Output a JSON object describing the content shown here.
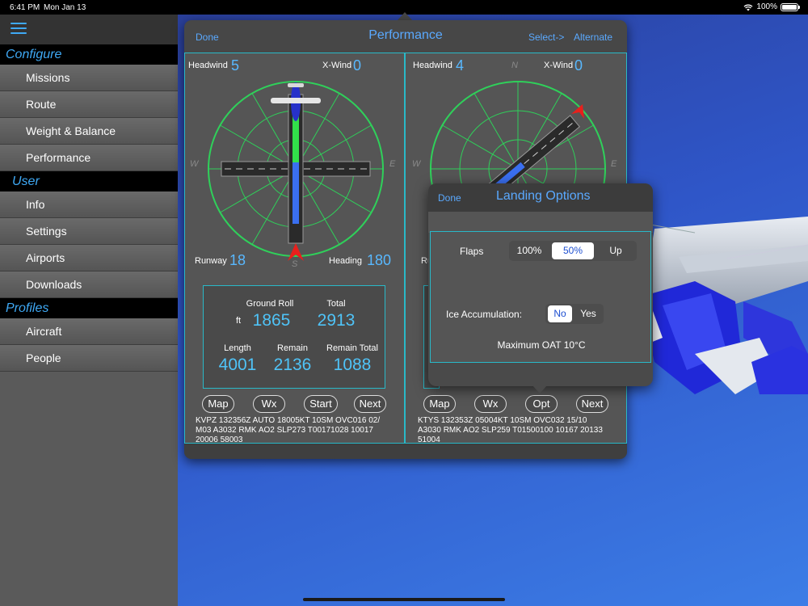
{
  "status_bar": {
    "time": "6:41 PM",
    "date": "Mon Jan 13",
    "battery": "100%"
  },
  "sidebar": {
    "sections": [
      {
        "title": "Configure",
        "items": [
          "Missions",
          "Route",
          "Weight & Balance",
          "Performance"
        ]
      },
      {
        "title": "User",
        "items": [
          "Info",
          "Settings",
          "Airports",
          "Downloads"
        ]
      },
      {
        "title": "Profiles",
        "items": [
          "Aircraft",
          "People"
        ]
      }
    ]
  },
  "performance": {
    "done_label": "Done",
    "title": "Performance",
    "select_label": "Select->",
    "alternate_label": "Alternate",
    "departure": {
      "headwind_label": "Headwind",
      "headwind": "5",
      "xwind_label": "X-Wind",
      "xwind": "0",
      "runway_label": "Runway",
      "runway": "18",
      "heading_label": "Heading",
      "heading": "180",
      "compass": {
        "w": "W",
        "e": "E",
        "s": "S"
      },
      "ground_roll_label": "Ground Roll",
      "total_label": "Total",
      "unit": "ft",
      "ground_roll": "1865",
      "total": "2913",
      "length_label": "Length",
      "remain_label": "Remain",
      "remain_total_label": "Remain Total",
      "length": "4001",
      "remain": "2136",
      "remain_total": "1088",
      "buttons": [
        "Map",
        "Wx",
        "Start",
        "Next"
      ],
      "metar": [
        "KVPZ 132356Z AUTO 18005KT 10SM OVC016 02/",
        "M03 A3032 RMK AO2 SLP273 T00171028 10017",
        "20006 58003"
      ]
    },
    "arrival": {
      "headwind_label": "Headwind",
      "headwind": "4",
      "xwind_label": "X-Wind",
      "xwind": "0",
      "runway_label_partial": "Ru",
      "compass": {
        "n": "N",
        "w": "W",
        "e": "E"
      },
      "buttons": [
        "Map",
        "Wx",
        "Opt",
        "Next"
      ],
      "metar": [
        "KTYS 132353Z 05004KT 10SM OVC032 15/10",
        "A3030 RMK AO2 SLP259 T01500100 10167 20133",
        "51004"
      ]
    }
  },
  "landing_options": {
    "done_label": "Done",
    "title": "Landing Options",
    "flaps_label": "Flaps",
    "flaps_options": [
      "100%",
      "50%",
      "Up"
    ],
    "flaps_selected": "50%",
    "ice_label": "Ice Accumulation:",
    "ice_options": [
      "No",
      "Yes"
    ],
    "ice_selected": "No",
    "max_oat": "Maximum OAT 10°C"
  },
  "colors": {
    "accent": "#5aa9ff",
    "value": "#4fc3f7",
    "border": "#29b9c8",
    "compass": "#2fd05a",
    "wind_arrow": "#e8201c"
  }
}
